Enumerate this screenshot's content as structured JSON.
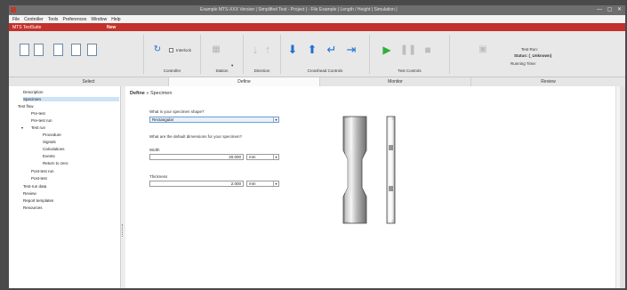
{
  "window": {
    "title": "Example MTS-XXX Version | Simplified Test - Project | - File Example | Length / Height | Simulation |",
    "controls": "— ▢ ✕"
  },
  "menu": [
    "File",
    "Controller",
    "Tools",
    "Preferences",
    "Window",
    "Help"
  ],
  "ribbon": {
    "title": "MTS TestSuite",
    "tag": "New"
  },
  "toolbar": {
    "groups": {
      "controller": "Controller",
      "station": "Station",
      "direction": "Direction",
      "crosshead": "Crosshead Controls",
      "test": "Test Controls"
    },
    "interlock_label": "Interlock",
    "station_dropdown": "▾",
    "status": {
      "test_run": "Test Run:",
      "status": "Status: (_Unknown)",
      "running_time": "Running Time:"
    }
  },
  "tabs": {
    "select": "Select",
    "define": "Define",
    "monitor": "Monitor",
    "review": "Review"
  },
  "tree": [
    "Description",
    "Specimen",
    "Test flow",
    "Pre-test",
    "Pre-test run",
    "Test run",
    "Procedure",
    "Signals",
    "Calculations",
    "Events",
    "Return to zero",
    "Post-test run",
    "Post-test",
    "Test-run data",
    "Review",
    "Report templates",
    "Resources"
  ],
  "breadcrumb": {
    "root": "Define",
    "sep": "»",
    "current": "Specimen"
  },
  "form": {
    "shape_question": "What is your specimen shape?",
    "shape_value": "Rectangular",
    "dims_question": "What are the default dimensions for your specimen?",
    "width_label": "Width",
    "width_value": "20.000",
    "width_unit": "mm",
    "thickness_label": "Thickness",
    "thickness_value": "2.000",
    "thickness_unit": "mm"
  },
  "icons": {
    "open": "folder-icon",
    "arrow_up_disabled": "arrow-up-icon",
    "arrow_down": "arrow-down-icon",
    "arrow_up": "arrow-up-icon",
    "return": "return-arrow-icon",
    "jump_end": "jump-to-end-icon",
    "play": "play-icon",
    "pause": "pause-icon",
    "stop": "stop-icon"
  },
  "colors": {
    "ribbon": "#c4302b",
    "accent_blue": "#1f6fd1",
    "play_green": "#2fae3a"
  }
}
